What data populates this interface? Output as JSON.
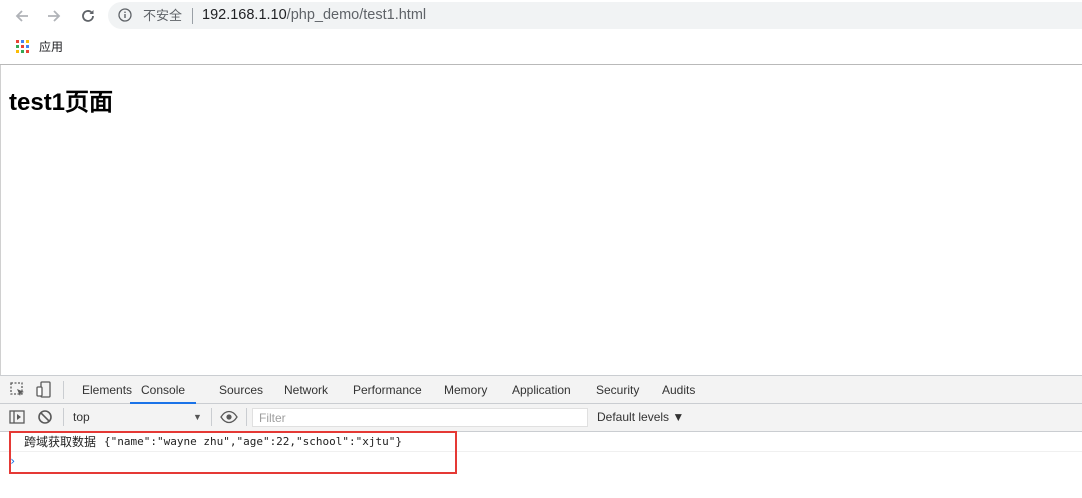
{
  "browser": {
    "security_label": "不安全",
    "url_host": "192.168.1.10",
    "url_path": "/php_demo/test1.html",
    "bookmarks": {
      "apps_label": "应用"
    }
  },
  "page": {
    "heading": "test1页面"
  },
  "devtools": {
    "tabs": [
      {
        "label": "Elements",
        "active": false
      },
      {
        "label": "Console",
        "active": true
      },
      {
        "label": "Sources",
        "active": false
      },
      {
        "label": "Network",
        "active": false
      },
      {
        "label": "Performance",
        "active": false
      },
      {
        "label": "Memory",
        "active": false
      },
      {
        "label": "Application",
        "active": false
      },
      {
        "label": "Security",
        "active": false
      },
      {
        "label": "Audits",
        "active": false
      }
    ],
    "console": {
      "context": "top",
      "filter_placeholder": "Filter",
      "levels_label": "Default levels ▼",
      "messages": [
        {
          "text": "跨域获取数据",
          "value": "{\"name\":\"wayne zhu\",\"age\":22,\"school\":\"xjtu\"}"
        }
      ],
      "prompt": "›"
    },
    "accent_color": "#1a73e8",
    "highlight_color": "#e53935"
  }
}
